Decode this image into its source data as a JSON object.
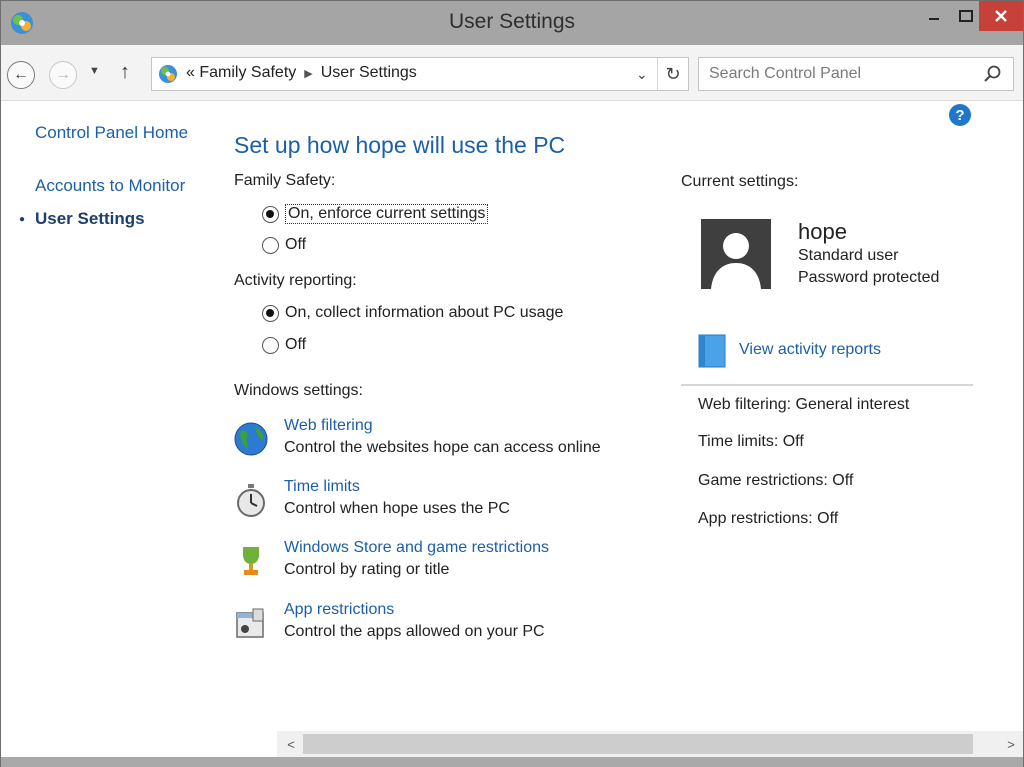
{
  "window": {
    "title": "User Settings",
    "minimize_label": "🗕",
    "maximize_label": "🗖",
    "close_label": "✕"
  },
  "nav": {
    "breadcrumb_prefix": "«",
    "breadcrumb": [
      "Family Safety",
      "User Settings"
    ],
    "search_placeholder": "Search Control Panel"
  },
  "sidebar": {
    "items": [
      {
        "label": "Control Panel Home"
      },
      {
        "label": "Accounts to Monitor"
      },
      {
        "label": "User Settings",
        "current": true
      }
    ]
  },
  "main": {
    "heading": "Set up how hope will use the PC",
    "family_safety": {
      "label": "Family Safety:",
      "options": [
        "On, enforce current settings",
        "Off"
      ],
      "selected": "On, enforce current settings"
    },
    "activity_reporting": {
      "label": "Activity reporting:",
      "options": [
        "On, collect information about PC usage",
        "Off"
      ],
      "selected": "On, collect information about PC usage"
    },
    "windows_settings": {
      "label": "Windows settings:",
      "items": [
        {
          "title": "Web filtering",
          "desc": "Control the websites hope can access online",
          "icon": "globe-icon"
        },
        {
          "title": "Time limits",
          "desc": "Control when hope uses the PC",
          "icon": "stopwatch-icon"
        },
        {
          "title": "Windows Store and game restrictions",
          "desc": "Control by rating or title",
          "icon": "trophy-icon"
        },
        {
          "title": "App restrictions",
          "desc": "Control the apps allowed on your PC",
          "icon": "app-window-icon"
        }
      ]
    }
  },
  "current": {
    "label": "Current settings:",
    "user": {
      "name": "hope",
      "type": "Standard user",
      "password": "Password protected"
    },
    "view_reports": "View activity reports",
    "summary": [
      "Web filtering: General interest",
      "Time limits: Off",
      "Game restrictions: Off",
      "App restrictions: Off"
    ]
  },
  "help": {
    "label": "?"
  },
  "colors": {
    "link": "#1c5fa8",
    "close_button": "#c7413a",
    "help": "#1e77c9"
  }
}
